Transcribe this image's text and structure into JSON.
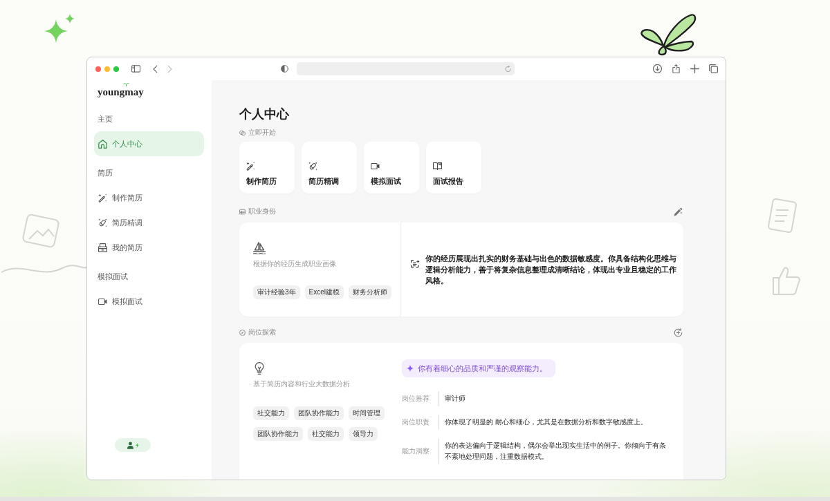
{
  "browser": {
    "nav": [
      {
        "kind": "back",
        "disabled": false
      },
      {
        "kind": "forward",
        "disabled": true
      }
    ]
  },
  "sidebar": {
    "logo": "youngmay",
    "sections": [
      {
        "title": "主页",
        "items": [
          {
            "kind": "home",
            "label": "个人中心",
            "selected": true
          }
        ]
      },
      {
        "title": "简历",
        "items": [
          {
            "kind": "create",
            "label": "制作简历",
            "selected": false
          },
          {
            "kind": "refine",
            "label": "简历精调",
            "selected": false
          },
          {
            "kind": "resumes",
            "label": "我的简历",
            "selected": false
          }
        ]
      },
      {
        "title": "模拟面试",
        "items": [
          {
            "kind": "interview",
            "label": "模拟面试",
            "selected": false
          }
        ]
      }
    ]
  },
  "main": {
    "title": "个人中心",
    "quick_start": {
      "label": "立即开始",
      "cards": [
        {
          "kind": "create",
          "label": "制作简历"
        },
        {
          "kind": "refine",
          "label": "简历精调"
        },
        {
          "kind": "interview",
          "label": "模拟面试"
        },
        {
          "kind": "report",
          "label": "面试报告"
        }
      ]
    },
    "career_identity": {
      "label": "职业身份",
      "subtitle": "根据你的经历生成职业画像",
      "tags": [
        "审计经验3年",
        "Excel建模",
        "财务分析师"
      ],
      "summary": "你的经历展现出扎实的财务基础与出色的数据敏感度。你具备结构化思维与逻辑分析能力，善于将复杂信息整理成清晰结论，体现出专业且稳定的工作风格。"
    },
    "job_exploration": {
      "label": "岗位探索",
      "subtitle": "基于简历内容和行业大数据分析",
      "tags": [
        "社交能力",
        "团队协作能力",
        "时间管理",
        "团队协作能力",
        "社交能力",
        "领导力"
      ],
      "highlight": "你有着细心的品质和严谨的观察能力。",
      "rows": [
        {
          "label": "岗位推荐",
          "value": "审计师"
        },
        {
          "label": "岗位职责",
          "value": "你体现了明显的 耐心和细心，尤其是在数据分析和数字敏感度上。"
        },
        {
          "label": "能力洞察",
          "value": "你的表达偏向于逻辑结构，偶尔会举出现实生活中的例子。你倾向于有条不紊地处理问题，注重数据模式。"
        }
      ]
    }
  }
}
